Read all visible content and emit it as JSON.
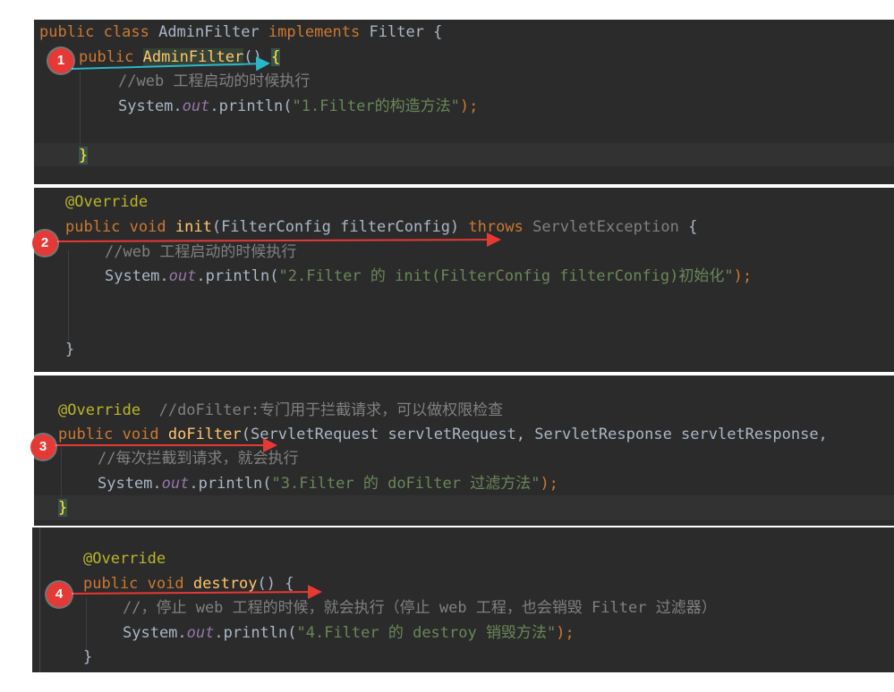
{
  "panels": [
    {
      "badge": "1",
      "lines": [
        [
          "public",
          " class ",
          "AdminFilter",
          " implements ",
          "Filter",
          " {"
        ],
        [
          "public",
          " ",
          "AdminFilter",
          "() ",
          "{"
        ],
        [
          "//web 工程启动的时候执行"
        ],
        [
          "System.",
          "out",
          ".println(",
          "\"1.Filter的构造方法\"",
          ");"
        ],
        [
          "}"
        ]
      ]
    },
    {
      "badge": "2",
      "lines": [
        [
          "@Override"
        ],
        [
          "public",
          " ",
          "void",
          " ",
          "init",
          "(FilterConfig filterConfig) ",
          "throws",
          " ",
          "ServletException",
          " {"
        ],
        [
          "//web 工程启动的时候执行"
        ],
        [
          "System.",
          "out",
          ".println(",
          "\"2.Filter 的 init(FilterConfig filterConfig)初始化\"",
          ");"
        ],
        [
          "}"
        ]
      ]
    },
    {
      "badge": "3",
      "lines": [
        [
          "@Override",
          "  //doFilter:专门用于拦截请求，可以做权限检查"
        ],
        [
          "public",
          " ",
          "void",
          " ",
          "doFilter",
          "(ServletRequest servletRequest, ServletResponse servletResponse,"
        ],
        [
          "//每次拦截到请求，就会执行"
        ],
        [
          "System.",
          "out",
          ".println(",
          "\"3.Filter 的 doFilter 过滤方法\"",
          ");"
        ],
        [
          "}"
        ]
      ]
    },
    {
      "badge": "4",
      "lines": [
        [
          "@Override"
        ],
        [
          "public",
          " ",
          "void",
          " ",
          "destroy",
          "() {"
        ],
        [
          "//，停止 web 工程的时候，就会执行（停止 web 工程，也会销毁 Filter 过滤器）"
        ],
        [
          "System.",
          "out",
          ".println(",
          "\"4.Filter 的 destroy 销毁方法\"",
          ");"
        ],
        [
          "}"
        ]
      ]
    }
  ],
  "colors": {
    "background": "#2b2b2b",
    "keyword": "#cc7832",
    "method": "#ffc66d",
    "annotation": "#bbb529",
    "string": "#6a8759",
    "comment": "#808080",
    "static_field": "#9876aa",
    "badge": "#e53935",
    "arrow_red": "#e53935",
    "arrow_cyan": "#29b6c9"
  }
}
